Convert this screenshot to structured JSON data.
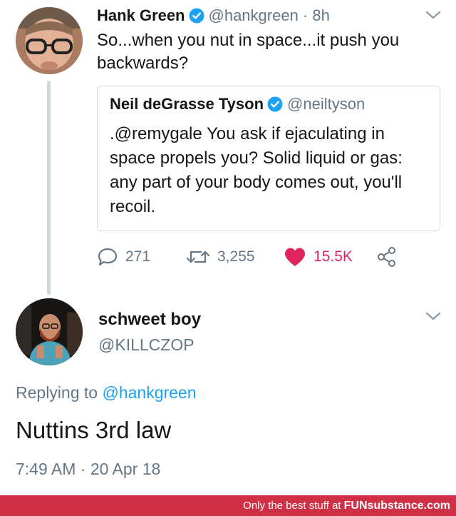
{
  "original_tweet": {
    "author_name": "Hank Green",
    "verified_icon": "verified-badge-icon",
    "handle_time": "@hankgreen · 8h",
    "text": "So...when you nut in space...it push you backwards?"
  },
  "quoted_tweet": {
    "author_name": "Neil deGrasse Tyson",
    "handle": "@neiltyson",
    "text": ".@remygale You ask if ejaculating in space propels you? Solid liquid or gas: any part of your body comes out, you'll recoil."
  },
  "actions": {
    "reply_count": "271",
    "retweet_count": "3,255",
    "like_count": "15.5K",
    "icons": [
      "reply-icon",
      "retweet-icon",
      "heart-icon",
      "share-icon"
    ]
  },
  "reply_tweet": {
    "author_name": "schweet boy",
    "handle": "@KILLCZOP",
    "replying_prefix": "Replying to ",
    "replying_mention": "@hankgreen",
    "text": "Nuttins 3rd law",
    "timestamp": "7:49 AM · 20 Apr 18"
  },
  "watermark": {
    "prefix": "Only the best stuff at ",
    "brand": "FUNsubstance.com"
  },
  "colors": {
    "link_blue": "#1da1f2",
    "muted_gray": "#657786",
    "like_red": "#e0245e",
    "watermark_bg": "#cf3045"
  }
}
